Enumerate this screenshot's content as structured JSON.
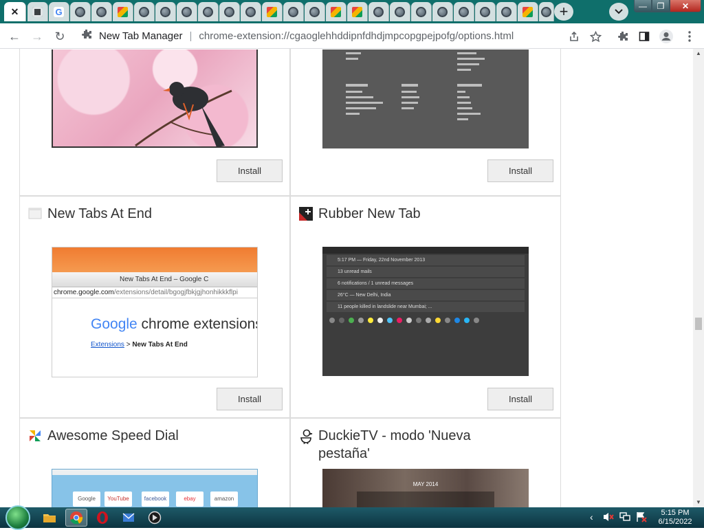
{
  "browser": {
    "tabs": [
      {
        "icon": "close-icon"
      },
      {
        "icon": "globe-icon"
      },
      {
        "icon": "google-icon",
        "glyph": "G"
      },
      {
        "icon": "globe-icon"
      },
      {
        "icon": "globe-icon"
      },
      {
        "icon": "news-icon"
      },
      {
        "icon": "globe-icon"
      },
      {
        "icon": "globe-icon"
      },
      {
        "icon": "globe-icon"
      },
      {
        "icon": "news-icon"
      },
      {
        "icon": "globe-icon"
      },
      {
        "icon": "globe-icon"
      },
      {
        "icon": "news-icon"
      },
      {
        "icon": "news-icon"
      },
      {
        "icon": "globe-icon"
      },
      {
        "icon": "globe-icon"
      },
      {
        "icon": "globe-icon"
      },
      {
        "icon": "globe-icon"
      },
      {
        "icon": "globe-icon"
      },
      {
        "icon": "news-icon"
      },
      {
        "icon": "globe-icon"
      }
    ],
    "new_tab_glyph": "+",
    "window_controls": {
      "minimize": "—",
      "maximize": "❐",
      "close": "✕"
    }
  },
  "toolbar": {
    "back": "←",
    "forward": "→",
    "reload": "↻",
    "site_name": "New Tab Manager",
    "separator": "|",
    "url": "chrome-extension://cgaoglehhddipnfdhdjmpcopgpejpofg/options.html"
  },
  "cards": [
    {
      "title": "",
      "install": "Install"
    },
    {
      "title": "",
      "install": "Install"
    },
    {
      "title": "New Tabs At End",
      "install": "Install",
      "icon": "blank-page-icon",
      "shot": {
        "tab_label": "New Tabs At End – Google C",
        "url_host": "chrome.google.com",
        "url_path": "/extensions/detail/bgogjfbkjgjhonhikkkflpi",
        "brand": "Google",
        "brand_suffix": " chrome extensions",
        "crumb_link": "Extensions",
        "crumb_sep": " > ",
        "crumb_current": "New Tabs At End"
      }
    },
    {
      "title": "Rubber New Tab",
      "install": "Install",
      "icon": "rubber-plus-icon",
      "shot": {
        "rows": [
          "5:17 PM — Friday, 22nd November 2013",
          "13 unread mails",
          "6 notifications / 1 unread messages",
          "26°C — New Delhi, India",
          "11 people killed in landslide near Mumbai; ..."
        ]
      }
    },
    {
      "title": "Awesome Speed Dial",
      "icon": "pinwheel-icon",
      "shot": {
        "tiles": [
          "Google",
          "YouTube",
          "facebook",
          "ebay",
          "amazon"
        ]
      }
    },
    {
      "title": "DuckieTV - modo 'Nueva pestaña'",
      "icon": "duck-icon",
      "shot": {
        "caption": "MAY 2014"
      }
    }
  ],
  "taskbar": {
    "apps": [
      "explorer-icon",
      "chrome-icon",
      "opera-icon",
      "outlook-icon",
      "media-player-icon"
    ],
    "tray_arrow": "‹",
    "time": "5:15 PM",
    "date": "6/15/2022"
  }
}
